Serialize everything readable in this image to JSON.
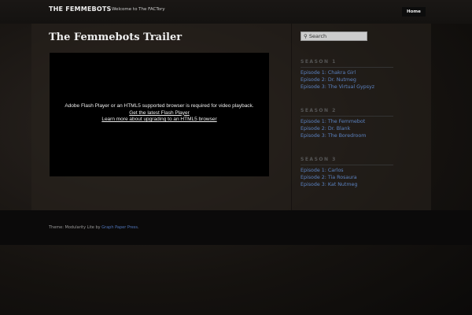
{
  "header": {
    "site_title": "THE FEMMEBOTS",
    "tagline": "Welcome to The FACTory",
    "nav_home": "Home"
  },
  "main": {
    "title": "The Femmebots Trailer",
    "video": {
      "message": "Adobe Flash Player or an HTML5 supported browser is required for video playback.",
      "link_flash": "Get the latest Flash Player",
      "link_html5": "Learn more about upgrading to an HTML5 browser"
    }
  },
  "sidebar": {
    "search_placeholder": "Search",
    "seasons": [
      {
        "title": "SEASON 1",
        "episodes": [
          "Episode 1: Chakra Girl",
          "Episode 2: Dr. Nutmeg",
          "Episode 3: The Virtual Gypsyz"
        ]
      },
      {
        "title": "SEASON 2",
        "episodes": [
          "Episode 1: The Femmebot",
          "Episode 2: Dr. Blank",
          "Episode 3: The Boredroom"
        ]
      },
      {
        "title": "SEASON 3",
        "episodes": [
          "Episode 1: Carlos",
          "Episode 2: Tia Rosaura",
          "Episode 3: Kat Nutmeg"
        ]
      }
    ]
  },
  "footer": {
    "prefix": "Theme: Modularity Lite by ",
    "link": "Graph Paper Press",
    "suffix": "."
  }
}
